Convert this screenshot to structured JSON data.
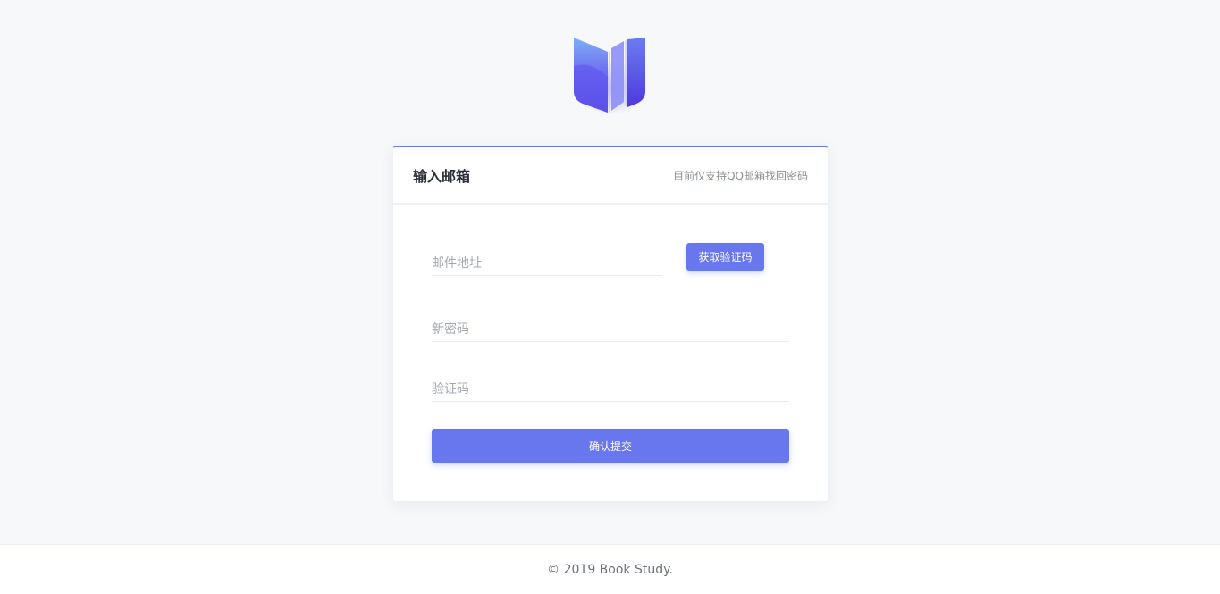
{
  "logo": {
    "icon": "book-icon",
    "colors": [
      "#7aa2f2",
      "#6a5af5",
      "#4f3ee0"
    ]
  },
  "card": {
    "title": "输入邮箱",
    "hint": "目前仅支持QQ邮箱找回密码",
    "accent": "#6877ee"
  },
  "form": {
    "email_placeholder": "邮件地址",
    "get_code_label": "获取验证码",
    "password_placeholder": "新密码",
    "code_placeholder": "验证码",
    "submit_label": "确认提交"
  },
  "footer": {
    "copyright": "© 2019 Book Study."
  }
}
